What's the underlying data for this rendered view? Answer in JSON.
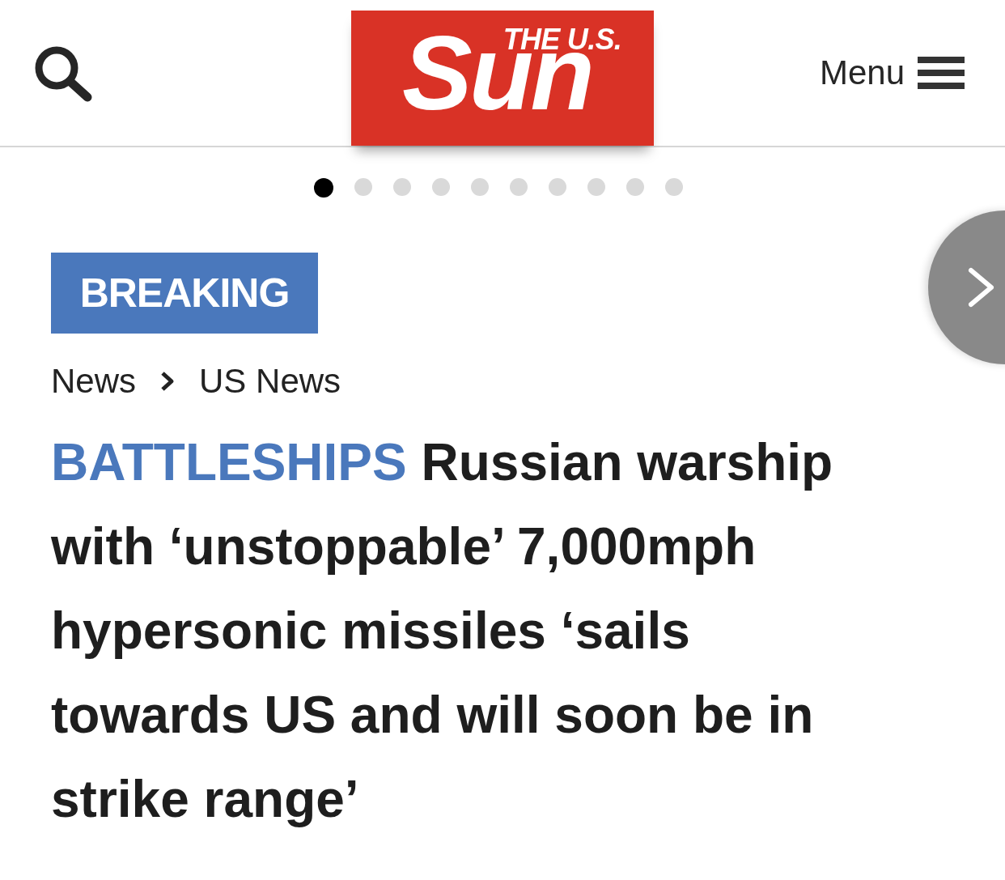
{
  "header": {
    "logo": {
      "tagline": "THE U.S.",
      "wordmark": "Sun"
    },
    "menu": {
      "label": "Menu"
    }
  },
  "carousel": {
    "dots": [
      {
        "selected": true
      },
      {
        "selected": false
      },
      {
        "selected": false
      },
      {
        "selected": false
      },
      {
        "selected": false
      },
      {
        "selected": false
      },
      {
        "selected": false
      },
      {
        "selected": false
      },
      {
        "selected": false
      },
      {
        "selected": false
      }
    ]
  },
  "article": {
    "badge": "BREAKING",
    "breadcrumbs": [
      "News",
      "US News"
    ],
    "headline": {
      "kicker": "BATTLESHIPS",
      "text": "Russian warship with ‘unstoppable’ 7,000mph hypersonic missiles ‘sails towards US and will soon be in strike range’"
    }
  }
}
